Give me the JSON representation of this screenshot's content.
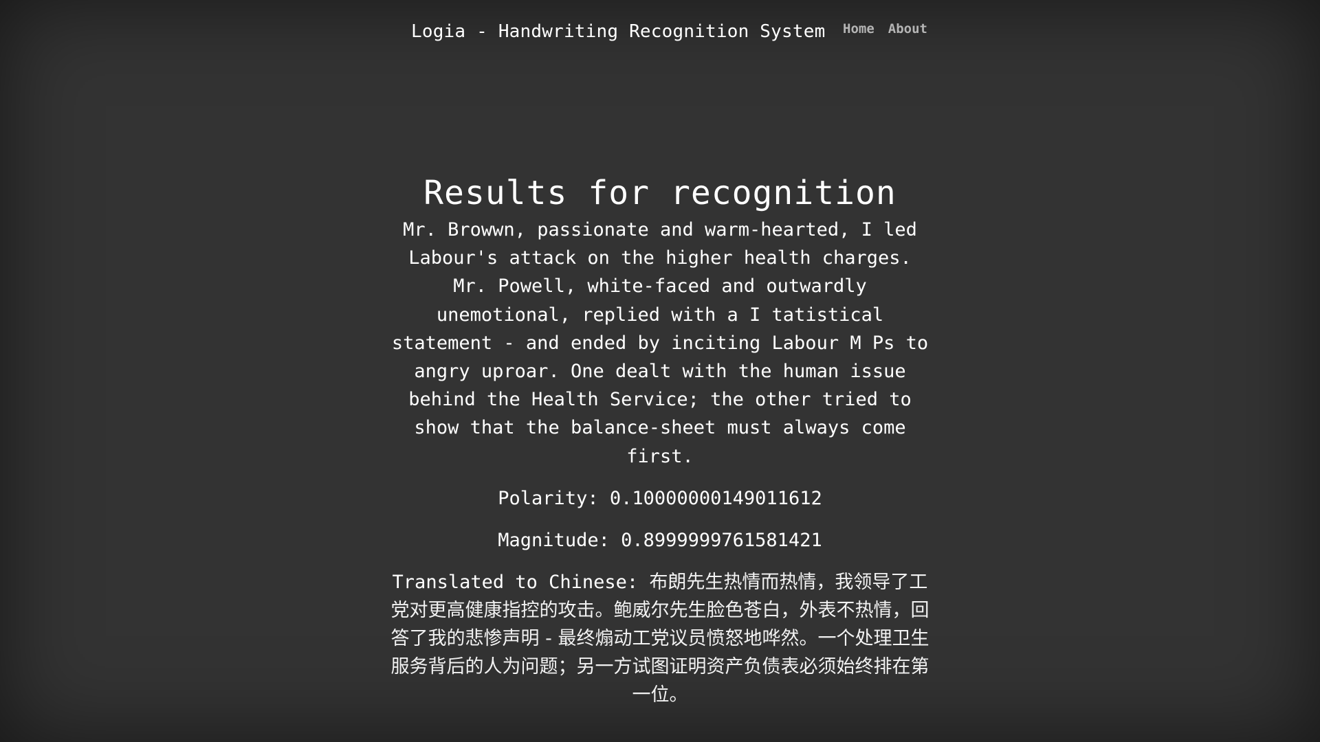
{
  "header": {
    "brand": "Logia - Handwriting Recognition System",
    "nav": [
      {
        "label": "Home"
      },
      {
        "label": "About"
      }
    ]
  },
  "main": {
    "title": "Results for recognition",
    "recognized_text": "Mr. Browwn, passionate and warm-hearted, I led Labour's attack on the higher health charges. Mr. Powell, white-faced and outwardly unemotional, replied with a I tatistical statement - and ended by inciting Labour M Ps to angry uproar. One dealt with the human issue behind the Health Service; the other tried to show that the balance-sheet must always come first.",
    "polarity": {
      "label": "Polarity:",
      "value": "0.10000000149011612"
    },
    "magnitude": {
      "label": "Magnitude:",
      "value": "0.8999999761581421"
    },
    "translation": {
      "label": "Translated to Chinese:",
      "text": "布朗先生热情而热情，我领导了工党对更高健康指控的攻击。鲍威尔先生脸色苍白，外表不热情，回答了我的悲惨声明 - 最终煽动工党议员愤怒地哗然。一个处理卫生服务背后的人为问题；另一方试图证明资产负债表必须始终排在第一位。"
    }
  }
}
